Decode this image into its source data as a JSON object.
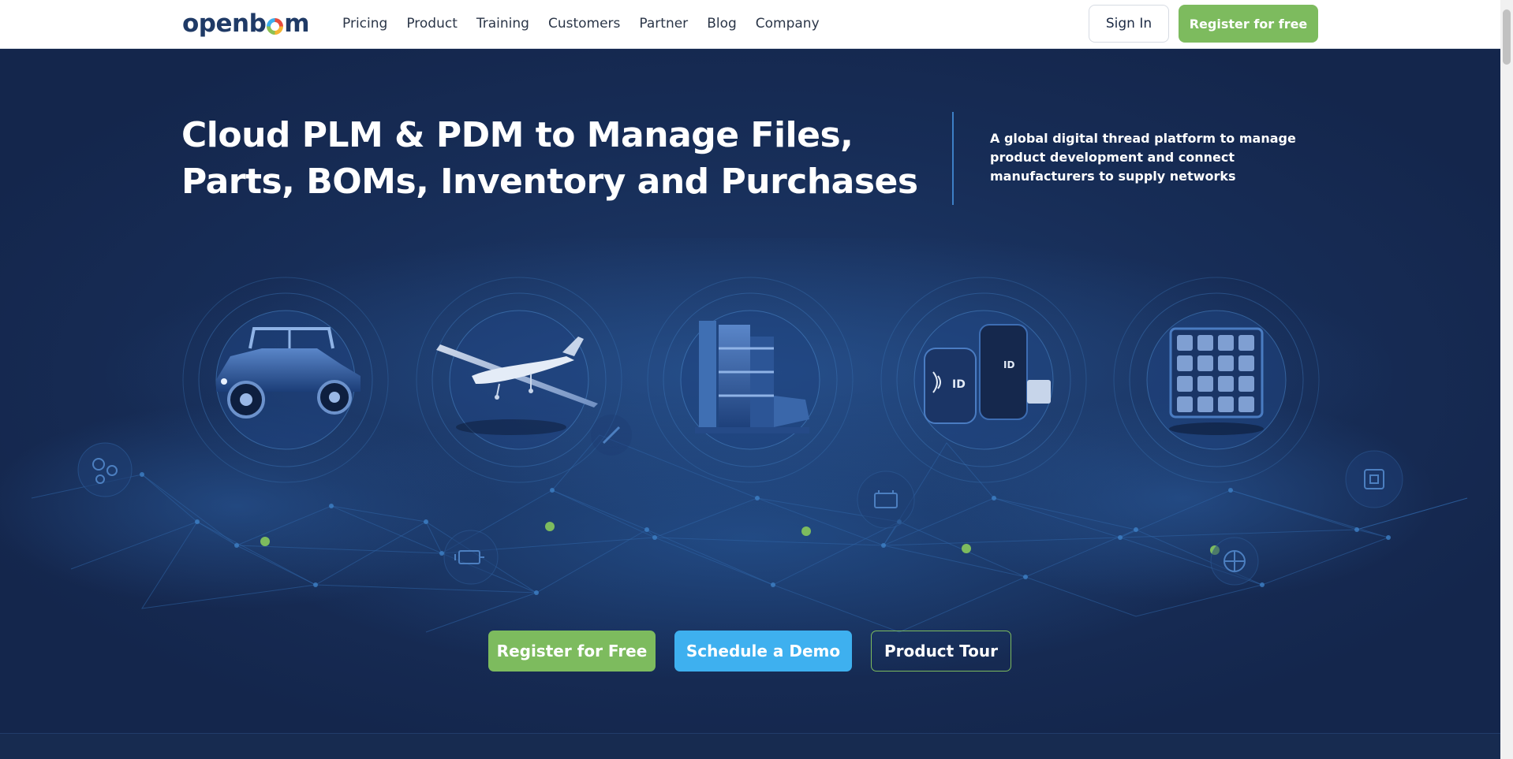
{
  "header": {
    "logo_text": "openbom",
    "nav": [
      "Pricing",
      "Product",
      "Training",
      "Customers",
      "Partner",
      "Blog",
      "Company"
    ],
    "sign_in_label": "Sign In",
    "register_label": "Register for free"
  },
  "hero": {
    "title": "Cloud PLM & PDM to Manage Files, Parts, BOMs, Inventory and Purchases",
    "subtitle": "A global digital thread platform to manage product development and connect manufacturers to supply networks",
    "products": [
      {
        "icon": "utv-vehicle-icon"
      },
      {
        "icon": "drone-airplane-icon"
      },
      {
        "icon": "industrial-machine-icon"
      },
      {
        "icon": "id-device-icon"
      },
      {
        "icon": "chocolate-box-icon"
      }
    ],
    "decor_icons": [
      "gears-icon",
      "engine-icon",
      "battery-icon",
      "pen-tool-icon",
      "chip-icon",
      "circuit-icon"
    ]
  },
  "cta": {
    "register_label": "Register for Free",
    "demo_label": "Schedule a Demo",
    "tour_label": "Product Tour"
  },
  "colors": {
    "accent_green": "#7dbb5e",
    "accent_blue": "#3eb0ef",
    "hero_bg": "#172d57",
    "brand_navy": "#1f3a66"
  }
}
